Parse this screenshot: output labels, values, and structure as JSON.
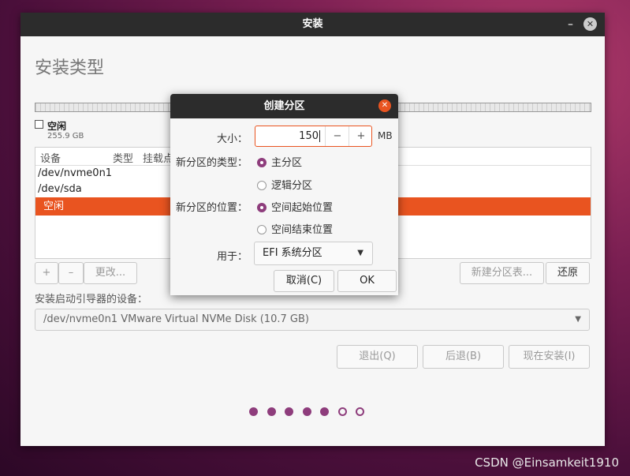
{
  "window": {
    "title": "安装",
    "minimize_glyph": "–",
    "close_glyph": "✕"
  },
  "page": {
    "title": "安装类型"
  },
  "legend": {
    "name": "空闲",
    "size": "255.9 GB"
  },
  "table": {
    "headers": [
      "设备",
      "类型",
      "挂载点"
    ],
    "rows": [
      "/dev/nvme0n1",
      "/dev/sda",
      "空闲"
    ]
  },
  "buttons": {
    "add": "+",
    "remove": "–",
    "change": "更改...",
    "new_table": "新建分区表...",
    "revert": "还原",
    "quit": "退出(Q)",
    "back": "后退(B)",
    "install": "现在安装(I)"
  },
  "boot": {
    "label": "安装启动引导器的设备：",
    "value": "/dev/nvme0n1 VMware Virtual NVMe Disk (10.7 GB)"
  },
  "progress": {
    "total_steps": 7,
    "completed_steps": 5
  },
  "dialog": {
    "title": "创建分区",
    "size_label": "大小：",
    "size_value": "150",
    "size_unit": "MB",
    "type_label": "新分区的类型：",
    "type_primary": "主分区",
    "type_logical": "逻辑分区",
    "type_selected": "primary",
    "location_label": "新分区的位置：",
    "location_start": "空间起始位置",
    "location_end": "空间结束位置",
    "location_selected": "start",
    "use_label": "用于：",
    "use_value": "EFI 系统分区",
    "cancel": "取消(C)",
    "ok": "OK"
  },
  "watermark": "CSDN @Einsamkeit1910",
  "colors": {
    "accent": "#e95420",
    "progress_dot": "#8e3d7c",
    "titlebar": "#2c2c2c"
  }
}
